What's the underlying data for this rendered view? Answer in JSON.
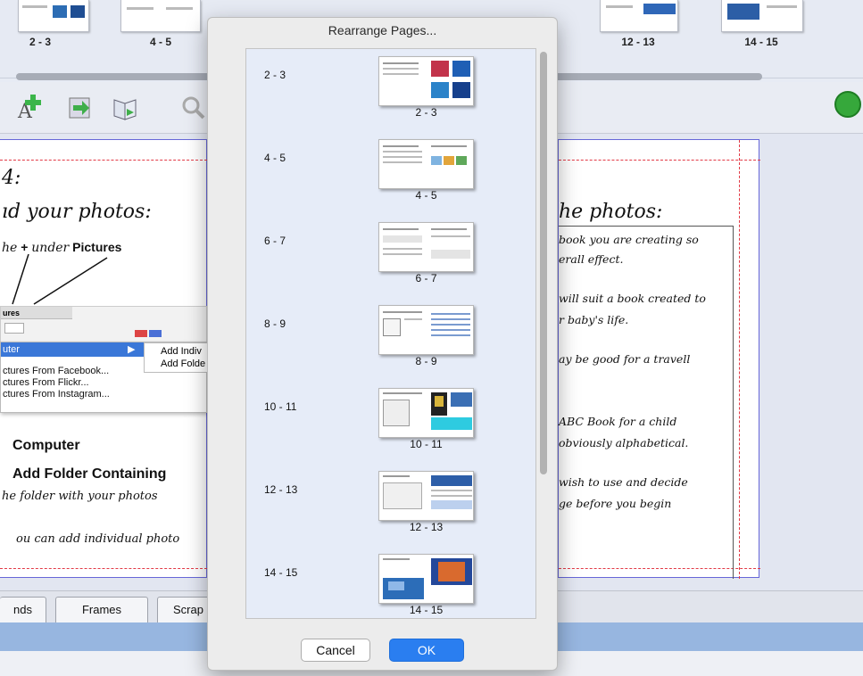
{
  "top_strip": {
    "spreads": [
      "2 - 3",
      "4 - 5",
      "12 - 13",
      "14 - 15"
    ]
  },
  "left_page": {
    "step": "4:",
    "heading": "ıd your photos:",
    "line1_a": "he",
    "line1_plus": "+",
    "line1_b": "under",
    "line1_bold": "Pictures",
    "snapshot_header": "ures",
    "menu_selected": "uter",
    "menu_items": [
      "ctures From Facebook...",
      "ctures From Flickr...",
      "ctures From Instagram..."
    ],
    "submenu_items": [
      "Add Indiv",
      "Add Folde"
    ],
    "computer": "Computer",
    "add_folder": "Add Folder Containing",
    "folder_line": "he folder with your photos",
    "individual_line": "ou can add individual photo"
  },
  "right_page": {
    "heading": "he photos:",
    "lines": [
      "book you are creating so",
      "erall effect.",
      "will suit a book created to",
      "r baby's life.",
      "ay be good for a travell",
      "ABC Book for a child",
      "obviously alphabetical.",
      "wish to use and decide",
      "ge before you begin"
    ]
  },
  "dialog": {
    "title": "Rearrange Pages...",
    "rows": [
      {
        "label": "2 - 3",
        "caption": "2 - 3"
      },
      {
        "label": "4 - 5",
        "caption": "4 - 5"
      },
      {
        "label": "6 - 7",
        "caption": "6 - 7"
      },
      {
        "label": "8 - 9",
        "caption": "8 - 9"
      },
      {
        "label": "10 - 11",
        "caption": "10 - 11"
      },
      {
        "label": "12 - 13",
        "caption": "12 - 13"
      },
      {
        "label": "14 - 15",
        "caption": "14 - 15"
      }
    ],
    "cancel": "Cancel",
    "ok": "OK"
  },
  "tabs": [
    "nds",
    "Frames",
    "Scrap"
  ],
  "colors": {
    "accent_blue": "#2a7ef0",
    "guide_red": "#e23a46",
    "page_border": "#6767d8"
  }
}
